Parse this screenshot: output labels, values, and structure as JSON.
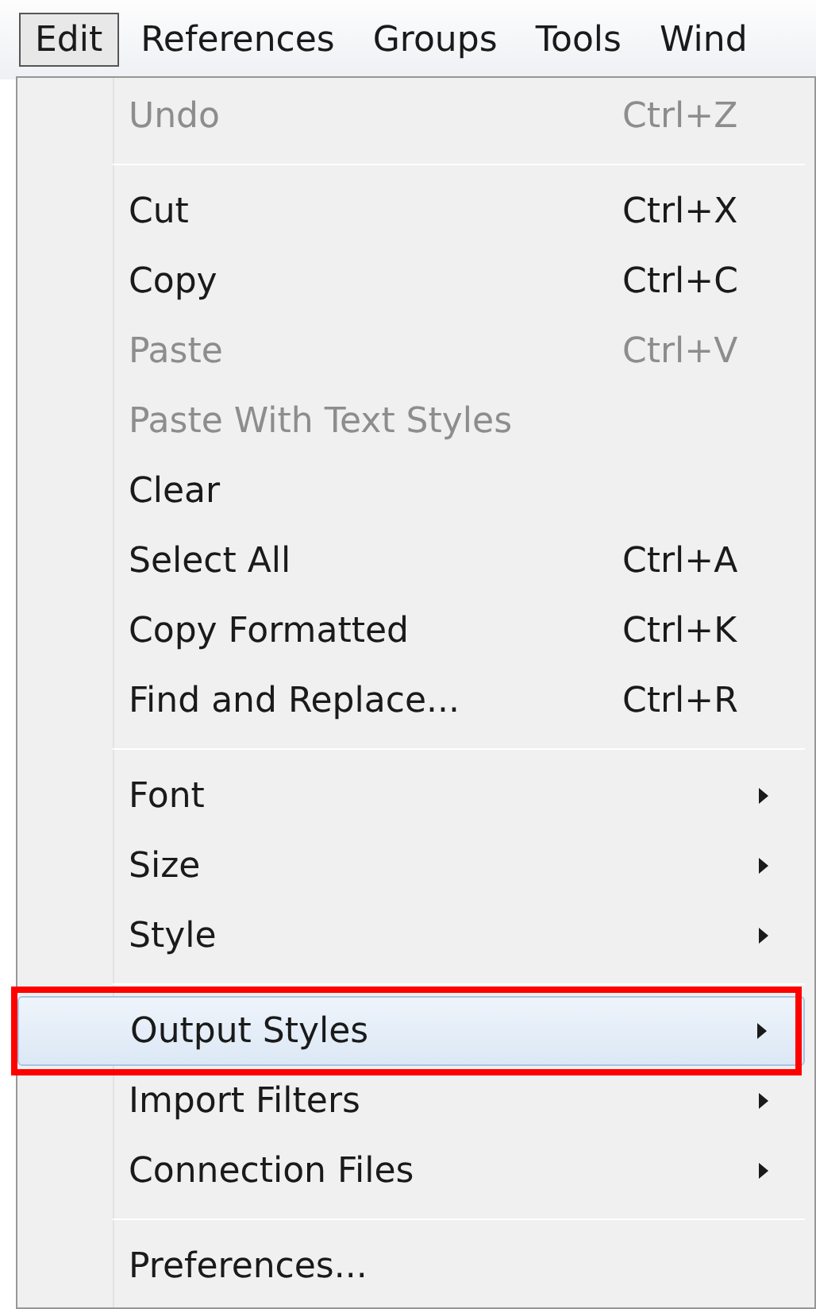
{
  "menubar": [
    {
      "label": "Edit",
      "selected": true
    },
    {
      "label": "References",
      "selected": false
    },
    {
      "label": "Groups",
      "selected": false
    },
    {
      "label": "Tools",
      "selected": false
    },
    {
      "label": "Wind",
      "selected": false
    }
  ],
  "menu": [
    {
      "kind": "command",
      "label": "Undo",
      "shortcut": "Ctrl+Z",
      "disabled": true,
      "selected": false,
      "annotated": false
    },
    {
      "kind": "separator"
    },
    {
      "kind": "command",
      "label": "Cut",
      "shortcut": "Ctrl+X",
      "disabled": false,
      "selected": false,
      "annotated": false
    },
    {
      "kind": "command",
      "label": "Copy",
      "shortcut": "Ctrl+C",
      "disabled": false,
      "selected": false,
      "annotated": false
    },
    {
      "kind": "command",
      "label": "Paste",
      "shortcut": "Ctrl+V",
      "disabled": true,
      "selected": false,
      "annotated": false
    },
    {
      "kind": "command",
      "label": "Paste With Text Styles",
      "disabled": true,
      "selected": false,
      "annotated": false
    },
    {
      "kind": "command",
      "label": "Clear",
      "disabled": false,
      "selected": false,
      "annotated": false
    },
    {
      "kind": "command",
      "label": "Select All",
      "shortcut": "Ctrl+A",
      "disabled": false,
      "selected": false,
      "annotated": false
    },
    {
      "kind": "command",
      "label": "Copy Formatted",
      "shortcut": "Ctrl+K",
      "disabled": false,
      "selected": false,
      "annotated": false
    },
    {
      "kind": "command",
      "label": "Find and Replace...",
      "shortcut": "Ctrl+R",
      "disabled": false,
      "selected": false,
      "annotated": false
    },
    {
      "kind": "separator"
    },
    {
      "kind": "submenu",
      "label": "Font",
      "disabled": false,
      "selected": false,
      "annotated": false
    },
    {
      "kind": "submenu",
      "label": "Size",
      "disabled": false,
      "selected": false,
      "annotated": false
    },
    {
      "kind": "submenu",
      "label": "Style",
      "disabled": false,
      "selected": false,
      "annotated": false
    },
    {
      "kind": "separator"
    },
    {
      "kind": "submenu",
      "label": "Output Styles",
      "disabled": false,
      "selected": true,
      "annotated": true
    },
    {
      "kind": "submenu",
      "label": "Import Filters",
      "disabled": false,
      "selected": false,
      "annotated": false
    },
    {
      "kind": "submenu",
      "label": "Connection Files",
      "disabled": false,
      "selected": false,
      "annotated": false
    },
    {
      "kind": "separator"
    },
    {
      "kind": "command",
      "label": "Preferences...",
      "disabled": false,
      "selected": false,
      "annotated": false
    }
  ]
}
